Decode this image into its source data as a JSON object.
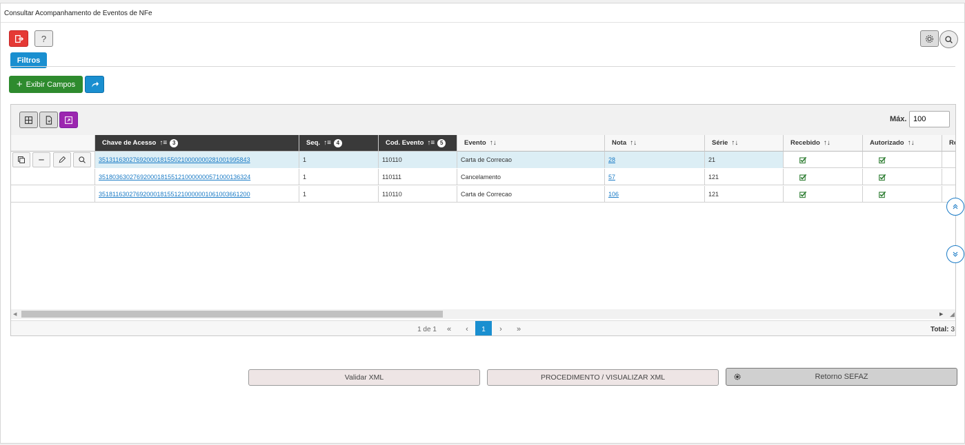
{
  "window": {
    "title": "Consultar Acompanhamento de Eventos de NFe"
  },
  "toolbar": {
    "exit_icon": "exit-icon",
    "help_label": "?",
    "filtros_label": "Filtros",
    "exibir_campos_label": "Exibir Campos",
    "plus_symbol": "+",
    "gear_icon": "gear-icon",
    "search_icon": "search-icon"
  },
  "grid": {
    "max_label": "Máx.",
    "max_value": "100",
    "columns": [
      {
        "label": "Chave de Acesso",
        "badge": "3"
      },
      {
        "label": "Seq.",
        "badge": "4"
      },
      {
        "label": "Cod. Evento",
        "badge": "5"
      },
      {
        "label": "Evento"
      },
      {
        "label": "Nota"
      },
      {
        "label": "Série"
      },
      {
        "label": "Recebido"
      },
      {
        "label": "Autorizado"
      },
      {
        "label": "Re"
      }
    ],
    "sort_glyph": "↑↓",
    "sort_active_glyph": "↑≡",
    "rows": [
      {
        "chave": "35131163027692000181550210000000281001995843",
        "seq": "1",
        "cod": "110110",
        "evento": "Carta de Correcao",
        "nota": "28",
        "serie": "21",
        "recebido": true,
        "autorizado": true
      },
      {
        "chave": "35180363027692000181551210000000571000136324",
        "seq": "1",
        "cod": "110111",
        "evento": "Cancelamento",
        "nota": "57",
        "serie": "121",
        "recebido": true,
        "autorizado": true
      },
      {
        "chave": "35181163027692000181551210000001061003661200",
        "seq": "1",
        "cod": "110110",
        "evento": "Carta de Correcao",
        "nota": "106",
        "serie": "121",
        "recebido": true,
        "autorizado": true
      }
    ],
    "pager": {
      "info": "1 de 1",
      "first": "«",
      "prev": "‹",
      "current": "1",
      "next": "›",
      "last": "»",
      "total_label": "Total:",
      "total_value": "3"
    }
  },
  "actions": {
    "validar_label": "Validar XML",
    "procedimento_label": "PROCEDIMENTO / VISUALIZAR XML",
    "retorno_label": "Retorno SEFAZ"
  },
  "colors": {
    "red": "#e53935",
    "blue": "#1a8fd0",
    "green": "#2e8b2e",
    "purple": "#9c27b0",
    "header_dark": "#3a3a3a",
    "selected_row": "#dceef5"
  }
}
